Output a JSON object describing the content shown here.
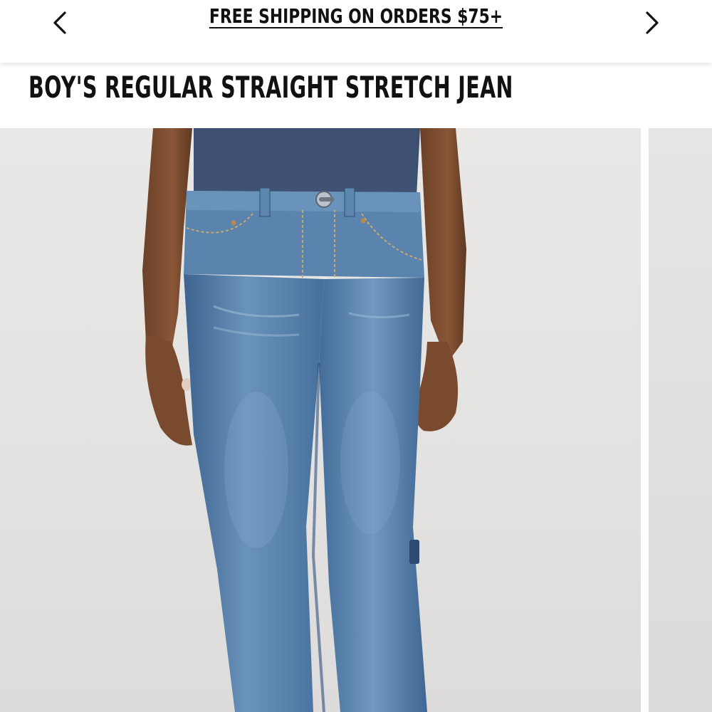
{
  "promo": {
    "text": "FREE SHIPPING ON ORDERS $75+",
    "prev_icon": "chevron-left-icon",
    "next_icon": "chevron-right-icon"
  },
  "product": {
    "title": "BOY'S REGULAR STRAIGHT STRETCH JEAN"
  },
  "gallery": {
    "slides": [
      {
        "subject": "product-photo-jeans-front"
      },
      {
        "subject": "product-photo-next-peek"
      }
    ]
  },
  "colors": {
    "text": "#111111",
    "background": "#ffffff",
    "photo_background": "#e6e5e3",
    "denim": "#4f7aa6",
    "shirt": "#3c4f6e"
  }
}
